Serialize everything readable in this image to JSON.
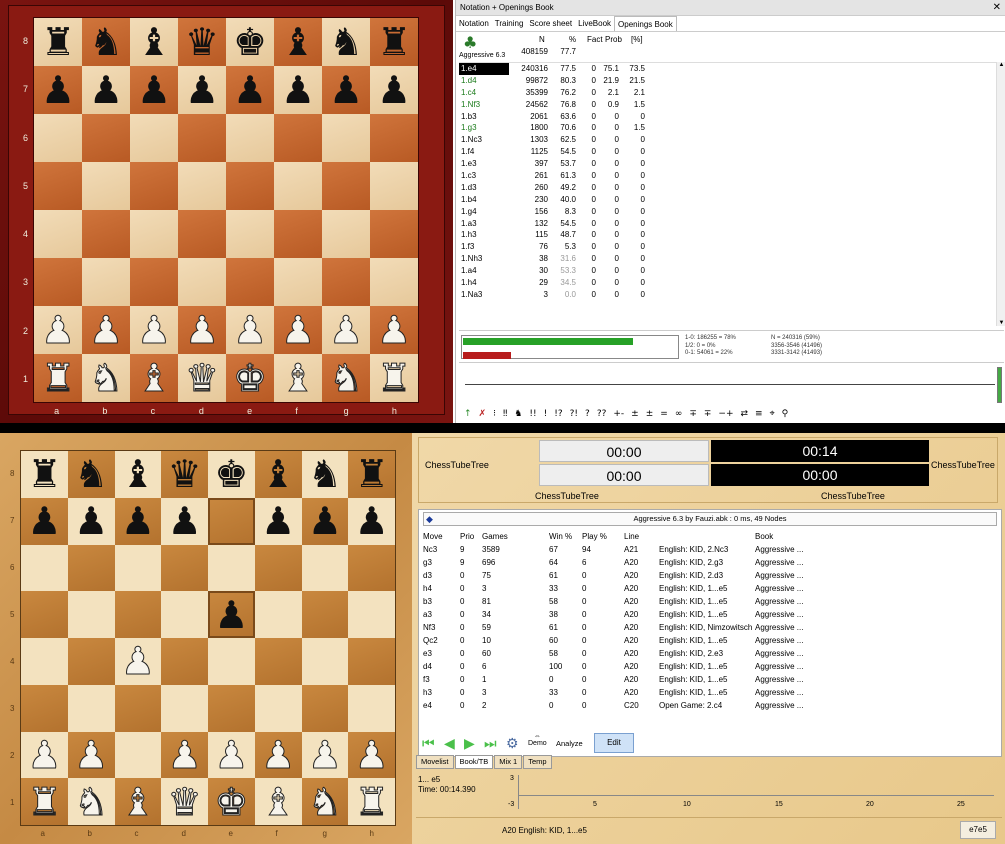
{
  "top_board": {
    "rows": [
      [
        "br",
        "bn",
        "bb",
        "bq",
        "bk",
        "bb",
        "bn",
        "br"
      ],
      [
        "bp",
        "bp",
        "bp",
        "bp",
        "bp",
        "bp",
        "bp",
        "bp"
      ],
      [
        "",
        "",
        "",
        "",
        "",
        "",
        "",
        ""
      ],
      [
        "",
        "",
        "",
        "",
        "",
        "",
        "",
        ""
      ],
      [
        "",
        "",
        "",
        "",
        "",
        "",
        "",
        ""
      ],
      [
        "",
        "",
        "",
        "",
        "",
        "",
        "",
        ""
      ],
      [
        "wp",
        "wp",
        "wp",
        "wp",
        "wp",
        "wp",
        "wp",
        "wp"
      ],
      [
        "wr",
        "wn",
        "wb",
        "wq",
        "wk",
        "wb",
        "wn",
        "wr"
      ]
    ],
    "ranks": [
      "8",
      "7",
      "6",
      "5",
      "4",
      "3",
      "2",
      "1"
    ],
    "files": [
      "a",
      "b",
      "c",
      "d",
      "e",
      "f",
      "g",
      "h"
    ]
  },
  "notation_panel": {
    "title": "Notation + Openings Book",
    "close": "✕",
    "tabs": [
      "Notation",
      "Training",
      "Score sheet",
      "LiveBook",
      "Openings Book"
    ],
    "book_name": "Aggressive 6.3",
    "headers": {
      "n": "N",
      "pct": "%",
      "fact": "Fact",
      "prob": "Prob",
      "pcb": "[%]"
    },
    "total": {
      "n": "408159",
      "pct": "77.7"
    },
    "rows": [
      {
        "mv": "1.e4",
        "n": "240316",
        "pct": "77.5",
        "f": "0",
        "pr": "75.1",
        "pc": "73.5",
        "style": "sel"
      },
      {
        "mv": "1.d4",
        "n": "99872",
        "pct": "80.3",
        "f": "0",
        "pr": "21.9",
        "pc": "21.5",
        "style": "green"
      },
      {
        "mv": "1.c4",
        "n": "35399",
        "pct": "76.2",
        "f": "0",
        "pr": "2.1",
        "pc": "2.1",
        "style": "green"
      },
      {
        "mv": "1.Nf3",
        "n": "24562",
        "pct": "76.8",
        "f": "0",
        "pr": "0.9",
        "pc": "1.5",
        "style": "green"
      },
      {
        "mv": "1.b3",
        "n": "2061",
        "pct": "63.6",
        "f": "0",
        "pr": "0",
        "pc": "0",
        "style": ""
      },
      {
        "mv": "1.g3",
        "n": "1800",
        "pct": "70.6",
        "f": "0",
        "pr": "0",
        "pc": "1.5",
        "style": "green"
      },
      {
        "mv": "1.Nc3",
        "n": "1303",
        "pct": "62.5",
        "f": "0",
        "pr": "0",
        "pc": "0",
        "style": ""
      },
      {
        "mv": "1.f4",
        "n": "1125",
        "pct": "54.5",
        "f": "0",
        "pr": "0",
        "pc": "0",
        "style": ""
      },
      {
        "mv": "1.e3",
        "n": "397",
        "pct": "53.7",
        "f": "0",
        "pr": "0",
        "pc": "0",
        "style": ""
      },
      {
        "mv": "1.c3",
        "n": "261",
        "pct": "61.3",
        "f": "0",
        "pr": "0",
        "pc": "0",
        "style": ""
      },
      {
        "mv": "1.d3",
        "n": "260",
        "pct": "49.2",
        "f": "0",
        "pr": "0",
        "pc": "0",
        "style": ""
      },
      {
        "mv": "1.b4",
        "n": "230",
        "pct": "40.0",
        "f": "0",
        "pr": "0",
        "pc": "0",
        "style": ""
      },
      {
        "mv": "1.g4",
        "n": "156",
        "pct": "8.3",
        "f": "0",
        "pr": "0",
        "pc": "0",
        "style": ""
      },
      {
        "mv": "1.a3",
        "n": "132",
        "pct": "54.5",
        "f": "0",
        "pr": "0",
        "pc": "0",
        "style": ""
      },
      {
        "mv": "1.h3",
        "n": "115",
        "pct": "48.7",
        "f": "0",
        "pr": "0",
        "pc": "0",
        "style": ""
      },
      {
        "mv": "1.f3",
        "n": "76",
        "pct": "5.3",
        "f": "0",
        "pr": "0",
        "pc": "0",
        "style": ""
      },
      {
        "mv": "1.Nh3",
        "n": "38",
        "pct": "31.6",
        "f": "0",
        "pr": "0",
        "pc": "0",
        "style": "graypct"
      },
      {
        "mv": "1.a4",
        "n": "30",
        "pct": "53.3",
        "f": "0",
        "pr": "0",
        "pc": "0",
        "style": "graypct"
      },
      {
        "mv": "1.h4",
        "n": "29",
        "pct": "34.5",
        "f": "0",
        "pr": "0",
        "pc": "0",
        "style": "graypct"
      },
      {
        "mv": "1.Na3",
        "n": "3",
        "pct": "0.0",
        "f": "0",
        "pr": "0",
        "pc": "0",
        "style": "graypct"
      }
    ],
    "stats": {
      "line1": "1-0: 186255 = 78%",
      "line2": "1/2: 0 = 0%",
      "line3": "0-1: 54061 = 22%",
      "line4": "N = 240316 (59%)",
      "line5": "3356-3546 (41496)",
      "line6": "3331-3142 (41493)",
      "green_fraction": 0.78,
      "red_fraction": 0.22
    },
    "symbols": [
      "↑",
      "✗",
      "⁝",
      "‼",
      "♞",
      "!!",
      "!",
      "!?",
      "?!",
      "?",
      "??",
      "+-",
      "±",
      "±",
      "=",
      "∞",
      "∓",
      "∓",
      "−+",
      "⇄",
      "≡",
      "⌖",
      "⚲"
    ]
  },
  "bottom_board": {
    "rows": [
      [
        "br",
        "bn",
        "bb",
        "bq",
        "bk",
        "bb",
        "bn",
        "br"
      ],
      [
        "bp",
        "bp",
        "bp",
        "bp",
        "",
        "bp",
        "bp",
        "bp"
      ],
      [
        "",
        "",
        "",
        "",
        "",
        "",
        "",
        ""
      ],
      [
        "",
        "",
        "",
        "",
        "bp",
        "",
        "",
        ""
      ],
      [
        "",
        "",
        "wp",
        "",
        "",
        "",
        "",
        ""
      ],
      [
        "",
        "",
        "",
        "",
        "",
        "",
        "",
        ""
      ],
      [
        "wp",
        "wp",
        "",
        "wp",
        "wp",
        "wp",
        "wp",
        "wp"
      ],
      [
        "wr",
        "wn",
        "wb",
        "wq",
        "wk",
        "wb",
        "wn",
        "wr"
      ]
    ],
    "ranks": [
      "8",
      "7",
      "6",
      "5",
      "4",
      "3",
      "2",
      "1"
    ],
    "files": [
      "a",
      "b",
      "c",
      "d",
      "e",
      "f",
      "g",
      "h"
    ]
  },
  "clock": {
    "left_name": "ChessTubeTree",
    "right_name": "ChessTubeTree",
    "left_bottom_name": "ChessTubeTree",
    "right_bottom_name": "ChessTubeTree",
    "t1": "00:00",
    "t2": "00:00",
    "t3": "00:14",
    "t4": "00:00"
  },
  "book2": {
    "title": "Aggressive 6.3 by Fauzi.abk : 0 ms, 49 Nodes",
    "headers": {
      "mv": "Move",
      "pr": "Prio",
      "g": "Games",
      "w": "Win %",
      "pl": "Play %",
      "ln": "Line",
      "bk": "Book"
    },
    "rows": [
      {
        "mv": "Nc3",
        "pr": "9",
        "g": "3589",
        "w": "67",
        "pl": "94",
        "eco": "A21",
        "ln": "English: KID, 2.Nc3",
        "bk": "Aggressive ..."
      },
      {
        "mv": "g3",
        "pr": "9",
        "g": "696",
        "w": "64",
        "pl": "6",
        "eco": "A20",
        "ln": "English: KID, 2.g3",
        "bk": "Aggressive ..."
      },
      {
        "mv": "d3",
        "pr": "0",
        "g": "75",
        "w": "61",
        "pl": "0",
        "eco": "A20",
        "ln": "English: KID, 2.d3",
        "bk": "Aggressive ..."
      },
      {
        "mv": "h4",
        "pr": "0",
        "g": "3",
        "w": "33",
        "pl": "0",
        "eco": "A20",
        "ln": "English: KID, 1...e5",
        "bk": "Aggressive ..."
      },
      {
        "mv": "b3",
        "pr": "0",
        "g": "81",
        "w": "58",
        "pl": "0",
        "eco": "A20",
        "ln": "English: KID, 1...e5",
        "bk": "Aggressive ..."
      },
      {
        "mv": "a3",
        "pr": "0",
        "g": "34",
        "w": "38",
        "pl": "0",
        "eco": "A20",
        "ln": "English: KID, 1...e5",
        "bk": "Aggressive ..."
      },
      {
        "mv": "Nf3",
        "pr": "0",
        "g": "59",
        "w": "61",
        "pl": "0",
        "eco": "A20",
        "ln": "English: KID, Nimzowitsch",
        "bk": "Aggressive ..."
      },
      {
        "mv": "Qc2",
        "pr": "0",
        "g": "10",
        "w": "60",
        "pl": "0",
        "eco": "A20",
        "ln": "English: KID, 1...e5",
        "bk": "Aggressive ..."
      },
      {
        "mv": "e3",
        "pr": "0",
        "g": "60",
        "w": "58",
        "pl": "0",
        "eco": "A20",
        "ln": "English: KID, 2.e3",
        "bk": "Aggressive ..."
      },
      {
        "mv": "d4",
        "pr": "0",
        "g": "6",
        "w": "100",
        "pl": "0",
        "eco": "A20",
        "ln": "English: KID, 1...e5",
        "bk": "Aggressive ..."
      },
      {
        "mv": "f3",
        "pr": "0",
        "g": "1",
        "w": "0",
        "pl": "0",
        "eco": "A20",
        "ln": "English: KID, 1...e5",
        "bk": "Aggressive ..."
      },
      {
        "mv": "h3",
        "pr": "0",
        "g": "3",
        "w": "33",
        "pl": "0",
        "eco": "A20",
        "ln": "English: KID, 1...e5",
        "bk": "Aggressive ..."
      },
      {
        "mv": "e4",
        "pr": "0",
        "g": "2",
        "w": "0",
        "pl": "0",
        "eco": "C20",
        "ln": "Open Game: 2.c4",
        "bk": "Aggressive ..."
      }
    ],
    "demo_label": "Demo",
    "analyze_label": "Analyze",
    "edit_label": "Edit",
    "tabs": [
      "Movelist",
      "Book/TB",
      "Mix 1",
      "Temp"
    ],
    "last_move": "1... e5",
    "time_label": "Time: 00:14.390",
    "eval_max": "3",
    "eval_min": "-3",
    "x_ticks": [
      "5",
      "10",
      "15",
      "20",
      "25"
    ],
    "status_line": "A20  English: KID, 1...e5",
    "status_move": "e7e5"
  }
}
